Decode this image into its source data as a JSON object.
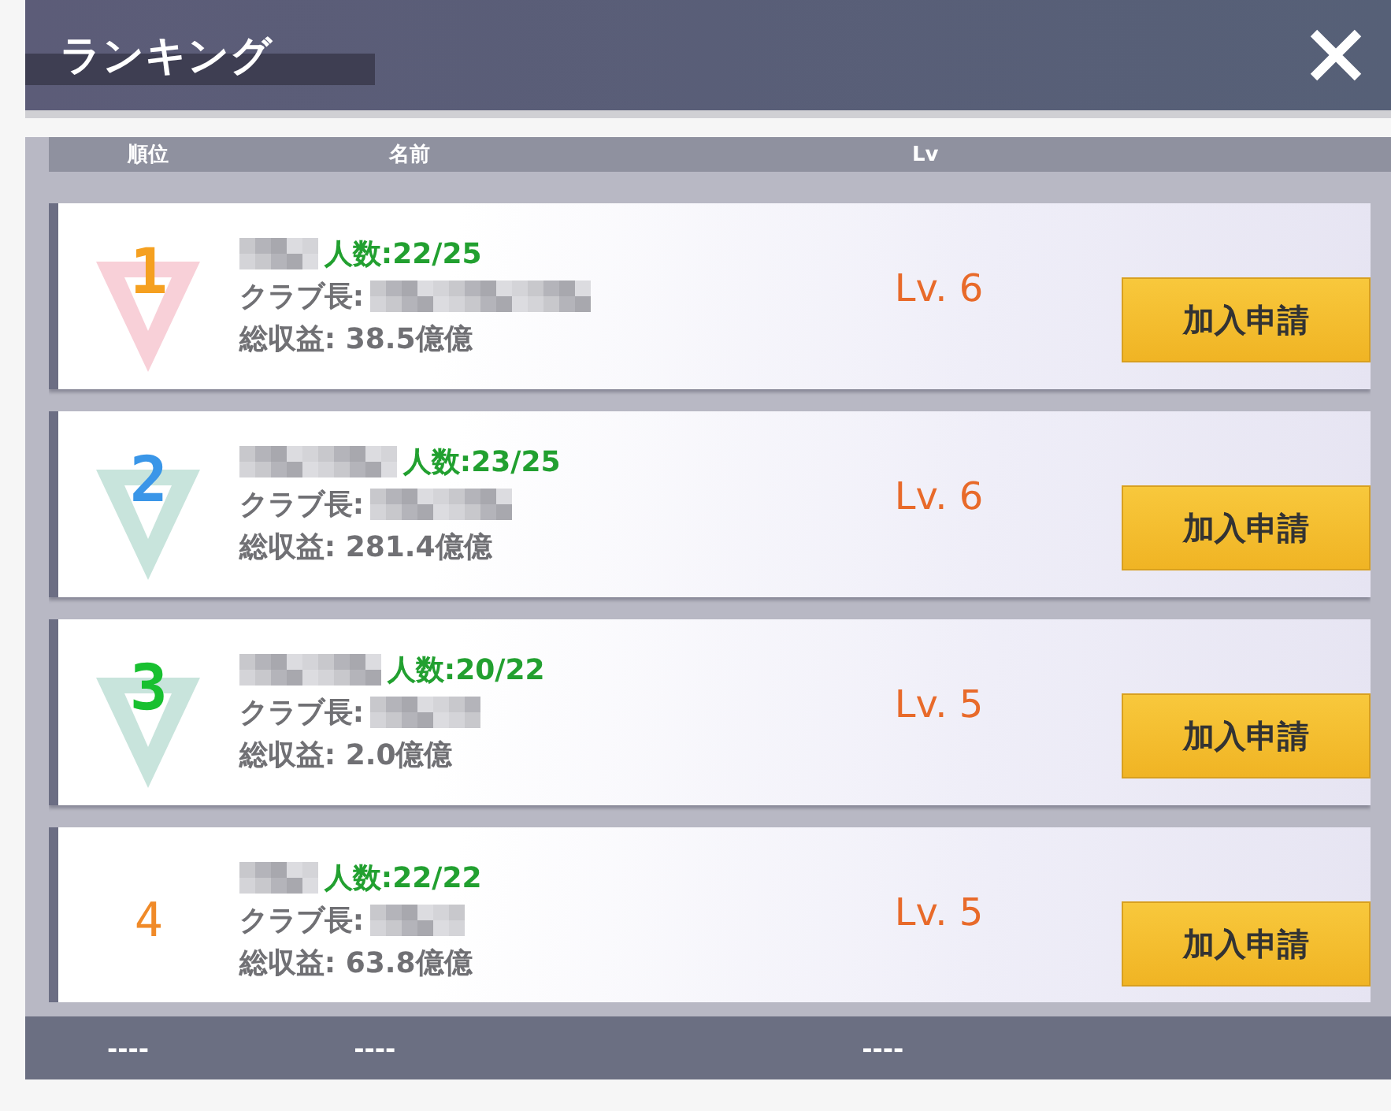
{
  "window": {
    "title": "ランキング"
  },
  "columns": [
    "順位",
    "名前",
    "Lv"
  ],
  "rows": [
    {
      "rank": "1",
      "kind": "medal",
      "color": "#f5a020",
      "members": "人数:22/25",
      "leader_label": "クラブ長:",
      "income": "総収益: 38.5億億",
      "level": "Lv. 6",
      "button": "加入申請"
    },
    {
      "rank": "2",
      "kind": "medal",
      "color": "#3a96e8",
      "members": "人数:23/25",
      "leader_label": "クラブ長:",
      "income": "総収益: 281.4億億",
      "level": "Lv. 6",
      "button": "加入申請"
    },
    {
      "rank": "3",
      "kind": "medal",
      "color": "#18c030",
      "members": "人数:20/22",
      "leader_label": "クラブ長:",
      "income": "総収益: 2.0億億",
      "level": "Lv. 5",
      "button": "加入申請"
    },
    {
      "rank": "4",
      "kind": "plain",
      "color": "#f08a28",
      "members": "人数:22/22",
      "leader_label": "クラブ長:",
      "income": "総収益: 63.8億億",
      "level": "Lv. 5",
      "button": "加入申請"
    }
  ],
  "footer": [
    "----",
    "----",
    "----"
  ]
}
